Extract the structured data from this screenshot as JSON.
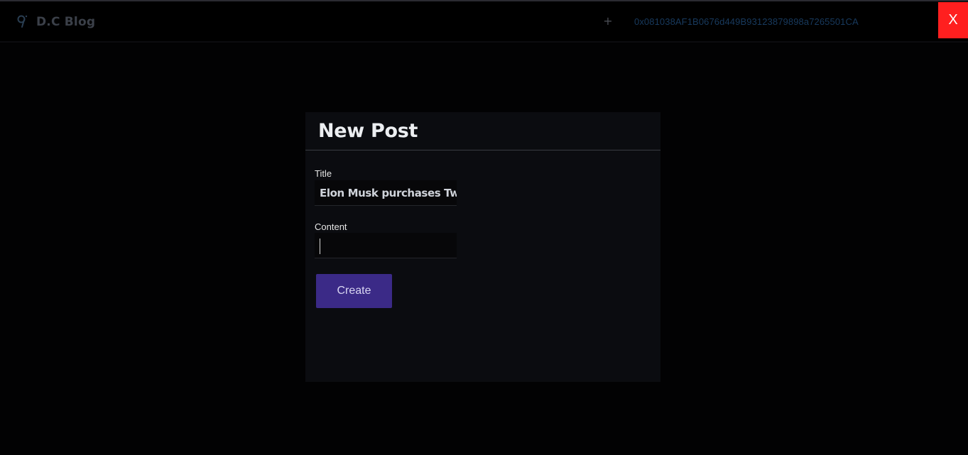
{
  "navbar": {
    "brand": "D.C Blog",
    "logo_icon": "blog-logo-icon",
    "new_post_label": "+",
    "wallet_address": "0x081038AF1B0676d449B93123879898a7265501CA",
    "close_label": "X"
  },
  "modal": {
    "title": "New Post",
    "title_field": {
      "label": "Title",
      "value": "Elon Musk purchases Twitter"
    },
    "content_field": {
      "label": "Content",
      "value": ""
    },
    "create_label": "Create"
  },
  "colors": {
    "background": "#020203",
    "modal_background": "#0b0c10",
    "create_button": "#3b2a87",
    "close_button": "#ff1f1f",
    "address_text": "#183a5e"
  }
}
